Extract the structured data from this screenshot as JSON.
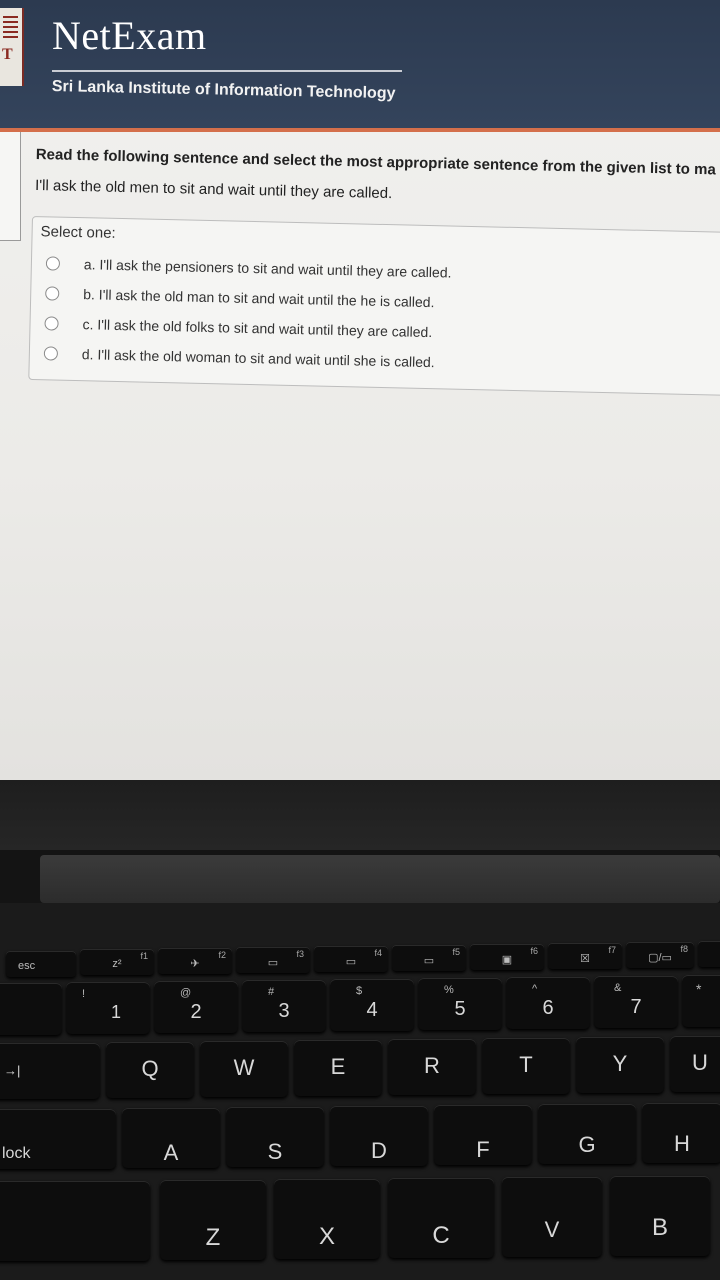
{
  "header": {
    "brand": "NetExam",
    "institute": "Sri Lanka Institute of Information Technology",
    "logo_letter": "T"
  },
  "question": {
    "prompt": "Read the following sentence and select the most appropriate sentence from the given list to ma",
    "sentence": "I'll ask the old men to sit and wait until they are called.",
    "select_label": "Select one:",
    "options": [
      {
        "label": "a. I'll ask the pensioners to sit and wait until they are called."
      },
      {
        "label": "b. I'll ask the old man to sit and wait until the he is called."
      },
      {
        "label": "c. I'll ask the old folks to sit and wait until they are called."
      },
      {
        "label": "d. I'll ask the old woman to sit and wait until she is called."
      }
    ]
  },
  "keyboard": {
    "function_row": [
      {
        "key": "esc",
        "label": "",
        "icon": ""
      },
      {
        "key": "f1",
        "label": "f1",
        "icon": "z²"
      },
      {
        "key": "f2",
        "label": "f2",
        "icon": "✈"
      },
      {
        "key": "f3",
        "label": "f3",
        "icon": "▭"
      },
      {
        "key": "f4",
        "label": "f4",
        "icon": "▭"
      },
      {
        "key": "f5",
        "label": "f5",
        "icon": "▭"
      },
      {
        "key": "f6",
        "label": "f6",
        "icon": "▣"
      },
      {
        "key": "f7",
        "label": "f7",
        "icon": "☒"
      },
      {
        "key": "f8",
        "label": "f8",
        "icon": "▢/▭"
      },
      {
        "key": "f9",
        "label": "f9",
        "icon": "▣"
      }
    ],
    "number_row": [
      {
        "main": "1",
        "sub": "!"
      },
      {
        "main": "2",
        "sub": "@"
      },
      {
        "main": "3",
        "sub": "#"
      },
      {
        "main": "4",
        "sub": "$"
      },
      {
        "main": "5",
        "sub": "%"
      },
      {
        "main": "6",
        "sub": "^"
      },
      {
        "main": "7",
        "sub": "&"
      },
      {
        "main": "",
        "sub": "*"
      }
    ],
    "top_row": [
      "Q",
      "W",
      "E",
      "R",
      "T",
      "Y",
      "U"
    ],
    "home_row": [
      "A",
      "S",
      "D",
      "F",
      "G",
      "H"
    ],
    "bottom_row": [
      "Z",
      "X",
      "C",
      "V",
      "B"
    ],
    "caps_label": "lock",
    "tab_symbol": "→|"
  }
}
